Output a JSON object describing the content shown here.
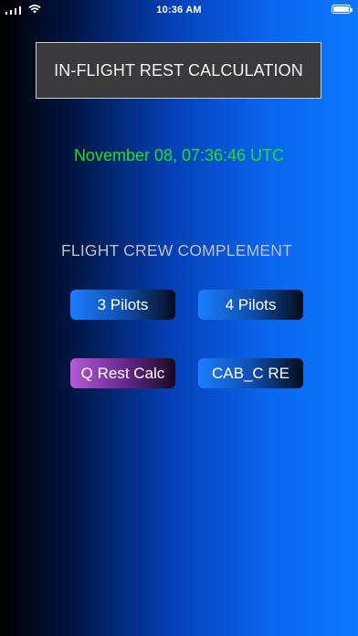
{
  "status_bar": {
    "time": "10:36 AM"
  },
  "title": "IN-FLIGHT REST CALCULATION",
  "datetime": "November 08, 07:36:46 UTC",
  "section_label": "FLIGHT CREW COMPLEMENT",
  "buttons": {
    "three_pilots": "3 Pilots",
    "four_pilots": "4 Pilots",
    "q_rest_calc": "Q Rest Calc",
    "cab_c_re": "CAB_C RE"
  },
  "colors": {
    "datetime_text": "#1fe02a",
    "title_box_bg": "#3a3a3c",
    "button_blue": "#1a7dff",
    "button_purple": "#b45ad6"
  }
}
